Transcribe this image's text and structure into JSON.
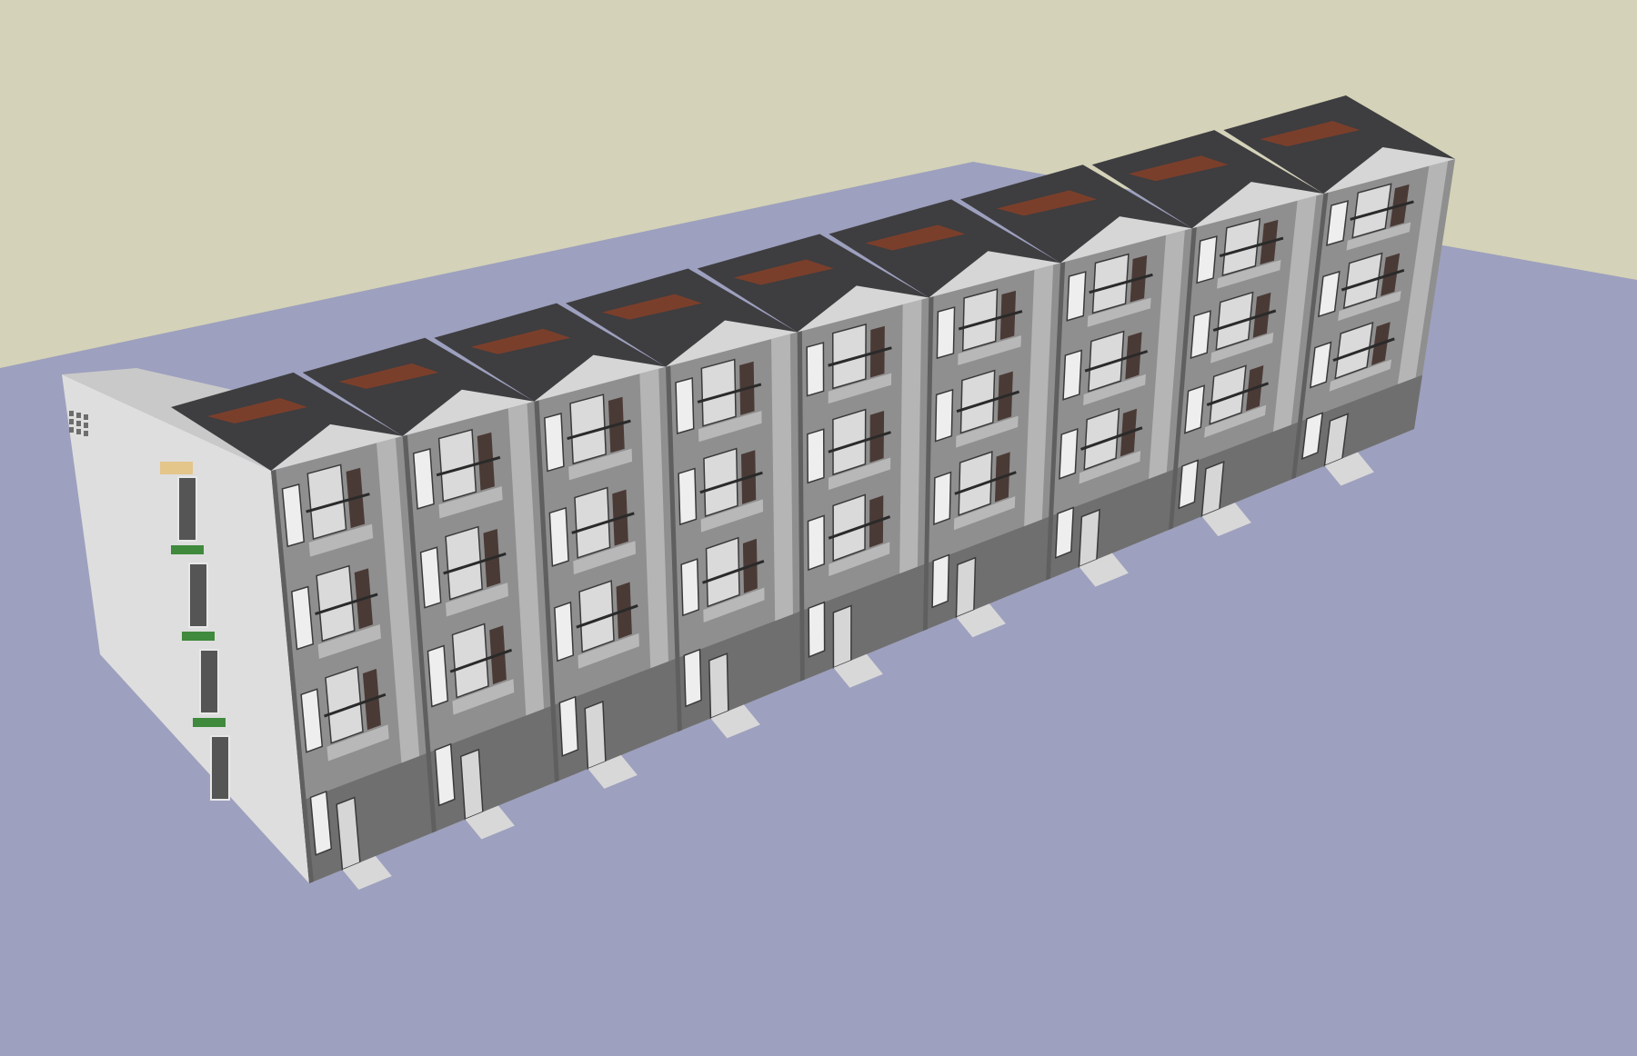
{
  "scene": {
    "sky_color": "#d4d2b8",
    "ground_color": "#9da0be",
    "wall_color": "#8f8f8f",
    "wall_dark": "#6f6f6f",
    "side_wall_color": "#dedede",
    "roof_color": "#3e3d40",
    "roof_tile_color": "#7a3f2b",
    "trim_color": "#e8e8e8",
    "shutter_color": "#4a3a36",
    "window_glass": "#eeeeee",
    "planter_color": "#3f8a3c",
    "lamp_color": "#e4c58a",
    "step_color": "#d8d8d8",
    "row_house_units": 9,
    "floors": 4,
    "icons": [
      "row-house-model",
      "ground-plane",
      "sky-backdrop"
    ]
  }
}
